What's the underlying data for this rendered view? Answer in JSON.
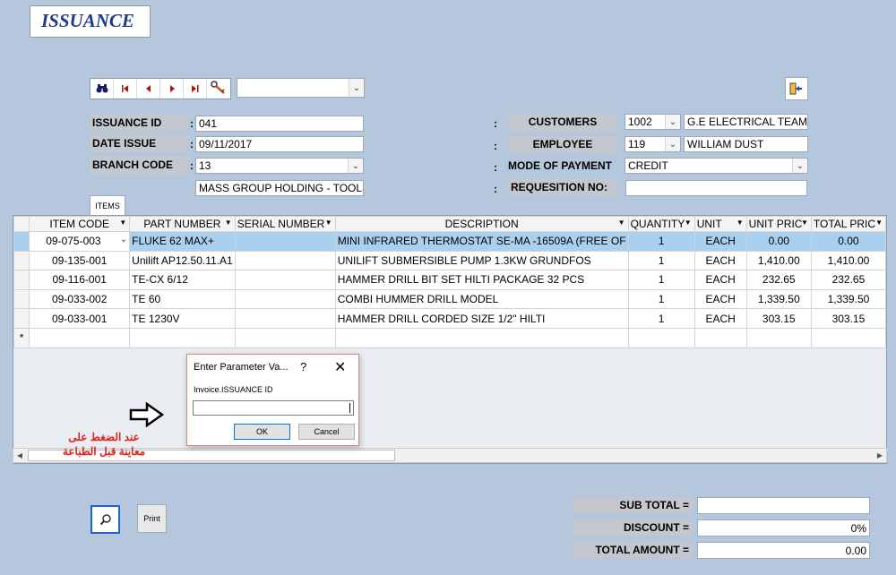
{
  "header": {
    "title": "ISSUANCE"
  },
  "toolbar": {
    "nav_icons": [
      "binoculars-icon",
      "first-record-icon",
      "previous-record-icon",
      "next-record-icon",
      "last-record-icon",
      "key-edit-icon"
    ],
    "search_combo_value": ""
  },
  "form": {
    "issuance_id_label": "ISSUANCE ID",
    "issuance_id_value": "041",
    "date_issue_label": "DATE ISSUE",
    "date_issue_value": "09/11/2017",
    "branch_code_label": "BRANCH CODE",
    "branch_code_value": "13",
    "branch_name": "MASS GROUP HOLDING - TOOLS",
    "colon": ":",
    "customers_label": "CUSTOMERS",
    "customers_code": "1002",
    "customers_name": "G.E ELECTRICAL TEAM",
    "employee_label": "EMPLOYEE",
    "employee_code": "119",
    "employee_name": "WILLIAM DUST",
    "mode_of_payment_label": "MODE OF PAYMENT",
    "mode_of_payment_value": "CREDIT",
    "requesition_label": "REQUESITION NO:",
    "requesition_value": ""
  },
  "tabs": {
    "items_label": "ITEMS"
  },
  "grid": {
    "columns": [
      "ITEM CODE",
      "PART NUMBER",
      "SERIAL NUMBER",
      "DESCRIPTION",
      "QUANTITY",
      "UNIT",
      "UNIT PRIC",
      "TOTAL PRIC"
    ],
    "rows": [
      [
        "09-075-003",
        "FLUKE 62 MAX+",
        "",
        "MINI INFRARED THERMOSTAT SE-MA -16509A (FREE OF",
        "1",
        "EACH",
        "0.00",
        "0.00"
      ],
      [
        "09-135-001",
        "Unilift AP12.50.11.A1",
        "",
        "UNILIFT SUBMERSIBLE PUMP 1.3KW GRUNDFOS",
        "1",
        "EACH",
        "1,410.00",
        "1,410.00"
      ],
      [
        "09-116-001",
        "TE-CX 6/12",
        "",
        "HAMMER DRILL BIT SET HILTI PACKAGE 32 PCS",
        "1",
        "EACH",
        "232.65",
        "232.65"
      ],
      [
        "09-033-002",
        "TE 60",
        "",
        "COMBI HUMMER DRILL MODEL",
        "1",
        "EACH",
        "1,339.50",
        "1,339.50"
      ],
      [
        "09-033-001",
        "TE 1230V",
        "",
        "HAMMER DRILL CORDED SIZE 1/2\" HILTI",
        "1",
        "EACH",
        "303.15",
        "303.15"
      ]
    ],
    "new_row_marker": "*"
  },
  "dialog": {
    "title": "Enter Parameter Va...",
    "help": "?",
    "close": "✕",
    "label": "Invoice.ISSUANCE ID",
    "input_value": "",
    "ok_label": "OK",
    "cancel_label": "Cancel"
  },
  "annotation": {
    "line1": "عند الضغط على",
    "line2": "معاينة قبل الطباعة"
  },
  "footer": {
    "print_label": "Print",
    "sub_total_label": "SUB TOTAL =",
    "sub_total_value": "",
    "discount_label": "DISCOUNT =",
    "discount_value": "0%",
    "total_amount_label": "TOTAL AMOUNT =",
    "total_amount_value": "0.00"
  },
  "colors": {
    "background": "#b5c7dc",
    "selected_row": "#aad0f0",
    "title_text": "#1f3a8a",
    "annotation_text": "#e0231a",
    "preview_button_border": "#1e64c8"
  }
}
